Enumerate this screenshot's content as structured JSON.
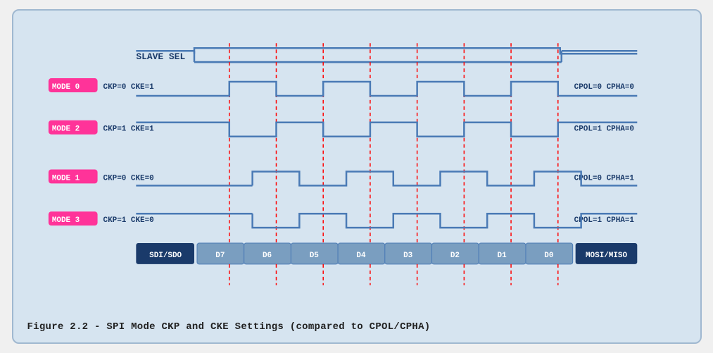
{
  "caption": "Figure 2.2 - SPI Mode CKP and CKE Settings (compared to CPOL/CPHA)",
  "diagram": {
    "slave_sel_label": "SLAVE SEL",
    "modes": [
      {
        "badge": "MODE 0",
        "left_label": "CKP=0  CKE=1",
        "right_label": "CPOL=0  CPHA=0"
      },
      {
        "badge": "MODE 2",
        "left_label": "CKP=1  CKE=1",
        "right_label": "CPOL=1  CPHA=0"
      },
      {
        "badge": "MODE 1",
        "left_label": "CKP=0  CKE=0",
        "right_label": "CPOL=0  CPHA=1"
      },
      {
        "badge": "MODE 3",
        "left_label": "CKP=1  CKE=0",
        "right_label": "CPOL=1  CPHA=1"
      }
    ],
    "data_bits": [
      "SDI/SDO",
      "D7",
      "D6",
      "D5",
      "D4",
      "D3",
      "D2",
      "D1",
      "D0",
      "MOSI/MISO"
    ]
  }
}
